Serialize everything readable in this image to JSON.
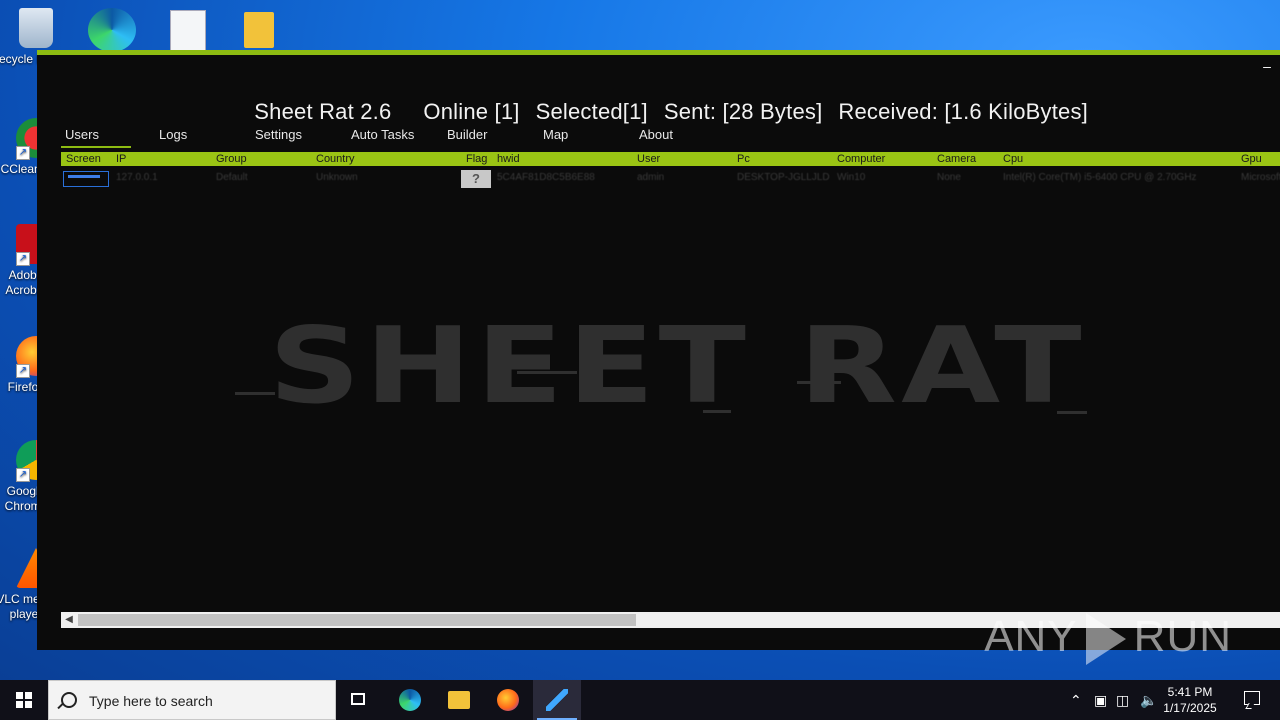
{
  "desktop": {
    "icons": [
      {
        "label": "Recycle Bin",
        "icon": "recycle-bin-icon"
      },
      {
        "label": "CCleaner",
        "icon": "ccleaner-icon"
      },
      {
        "label": "Adobe Acrobat",
        "icon": "acrobat-icon"
      },
      {
        "label": "Firefox",
        "icon": "firefox-icon"
      },
      {
        "label": "Google Chrome",
        "icon": "chrome-icon"
      },
      {
        "label": "VLC media player",
        "icon": "vlc-icon"
      }
    ],
    "top_icons": [
      "edge-icon",
      "image-file-icon",
      "folder-icon"
    ]
  },
  "app": {
    "title": "Sheet Rat 2.6",
    "online": "Online [1]",
    "selected": "Selected[1]",
    "sent": "Sent: [28 Bytes]",
    "received": "Received: [1.6 KiloBytes]",
    "minimize": "–",
    "menu": [
      {
        "label": "Users"
      },
      {
        "label": "Logs"
      },
      {
        "label": "Settings"
      },
      {
        "label": "Auto Tasks"
      },
      {
        "label": "Builder"
      },
      {
        "label": "Map"
      },
      {
        "label": "About"
      }
    ],
    "columns": [
      "Screen",
      "IP",
      "Group",
      "Country",
      "Flag",
      "hwid",
      "User",
      "Pc",
      "Computer",
      "Camera",
      "Cpu",
      "Gpu"
    ],
    "row": {
      "ip": "127.0.0.1",
      "group": "Default",
      "country": "Unknown",
      "flag": "?",
      "hwid": "5C4AF81D8C5B6E88",
      "user": "admin",
      "pc": "DESKTOP-JGLLJLD",
      "computer": "Win10",
      "camera": "None",
      "cpu": "Intel(R) Core(TM) i5-6400 CPU @ 2.70GHz",
      "gpu": "Microsoft"
    },
    "watermark": "SHEET RAT",
    "colors": {
      "accent": "#9ac414",
      "background": "#0b0b0b"
    }
  },
  "anyrun": {
    "left": "ANY",
    "right": "RUN"
  },
  "taskbar": {
    "search_placeholder": "Type here to search",
    "time": "5:41 PM",
    "date": "1/17/2025"
  }
}
